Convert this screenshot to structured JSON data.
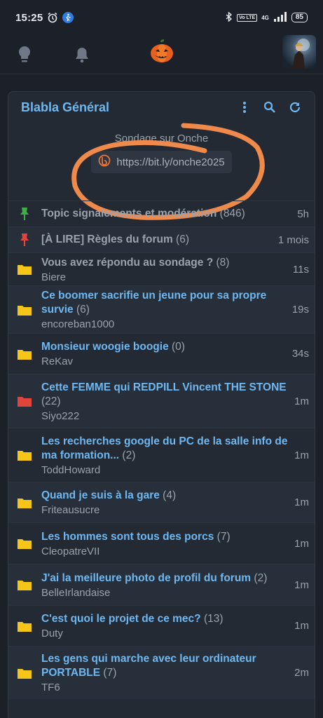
{
  "statusbar": {
    "time": "15:25",
    "battery": "85",
    "network": "4G",
    "lte": "Vo LTE"
  },
  "appbar": {
    "logo": "pumpkin-logo"
  },
  "card": {
    "title": "Blabla Général",
    "poll_title": "Sondage sur Onche",
    "poll_link": "https://bit.ly/onche2025"
  },
  "colors": {
    "accent": "#6fb7f0",
    "annotation": "#f08a4b",
    "pin_green": "#3fae49",
    "pin_red": "#e0443a",
    "folder_yellow": "#f5c518",
    "folder_red": "#e0443a"
  },
  "topics": [
    {
      "title": "Topic signalements et modération",
      "count": "(846)",
      "author": "",
      "time": "5h",
      "icon": "pin-green-icon",
      "read": true
    },
    {
      "title": "[À LIRE] Règles du forum",
      "count": "(6)",
      "author": "",
      "time": "1 mois",
      "icon": "pin-red-icon",
      "read": true
    },
    {
      "title": "Vous avez répondu au sondage ?",
      "count": "(8)",
      "author": "Biere",
      "time": "11s",
      "icon": "folder-yellow-icon",
      "read": true
    },
    {
      "title": "Ce boomer sacrifie un jeune pour sa propre survie",
      "count": "(6)",
      "author": "encoreban1000",
      "time": "19s",
      "icon": "folder-yellow-icon",
      "read": false
    },
    {
      "title": "Monsieur woogie boogie",
      "count": "(0)",
      "author": "ReKav",
      "time": "34s",
      "icon": "folder-yellow-icon",
      "read": false
    },
    {
      "title": "Cette FEMME qui REDPILL Vincent THE STONE",
      "count": "(22)",
      "author": "Siyo222",
      "time": "1m",
      "icon": "folder-red-icon",
      "read": false
    },
    {
      "title": "Les recherches google du PC de la salle info de ma formation...",
      "count": "(2)",
      "author": "ToddHoward",
      "time": "1m",
      "icon": "folder-yellow-icon",
      "read": false
    },
    {
      "title": "Quand je suis à la gare",
      "count": "(4)",
      "author": "Friteausucre",
      "time": "1m",
      "icon": "folder-yellow-icon",
      "read": false
    },
    {
      "title": "Les hommes sont tous des porcs",
      "count": "(7)",
      "author": "CleopatreVII",
      "time": "1m",
      "icon": "folder-yellow-icon",
      "read": false
    },
    {
      "title": "J'ai la meilleure photo de profil du forum",
      "count": "(2)",
      "author": "BelleIrlandaise",
      "time": "1m",
      "icon": "folder-yellow-icon",
      "read": false
    },
    {
      "title": "C'est quoi le projet de ce mec?",
      "count": "(13)",
      "author": "Duty",
      "time": "1m",
      "icon": "folder-yellow-icon",
      "read": false
    },
    {
      "title": "Les gens qui marche avec leur ordinateur PORTABLE",
      "count": "(7)",
      "author": "TF6",
      "time": "2m",
      "icon": "folder-yellow-icon",
      "read": false
    }
  ]
}
